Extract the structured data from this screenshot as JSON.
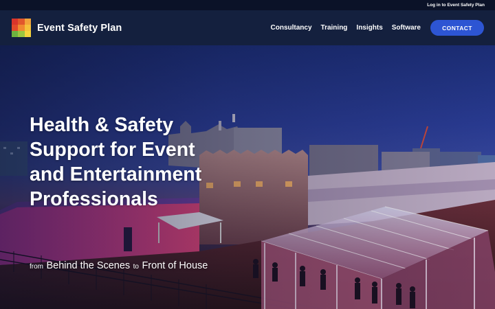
{
  "topbar": {
    "login_link": "Log in to Event Safety Plan"
  },
  "header": {
    "brand": "Event Safety Plan",
    "logo_colors": [
      "#d9352b",
      "#e2582c",
      "#f2a33a",
      "#e24a2b",
      "#f08a30",
      "#f5c23a",
      "#6db33f",
      "#9cc640",
      "#f6d33c"
    ],
    "nav": [
      {
        "label": "Consultancy"
      },
      {
        "label": "Training"
      },
      {
        "label": "Insights"
      },
      {
        "label": "Software"
      }
    ],
    "contact_label": "CONTACT",
    "accent_color": "#2d55d3"
  },
  "hero": {
    "title_lines": [
      "Health & Safety",
      "Support for Event",
      "and Entertainment",
      "Professionals"
    ],
    "subtitle": {
      "part1": "from",
      "part2": "Behind the Scenes",
      "part3": "to",
      "part4": "Front of House"
    }
  }
}
